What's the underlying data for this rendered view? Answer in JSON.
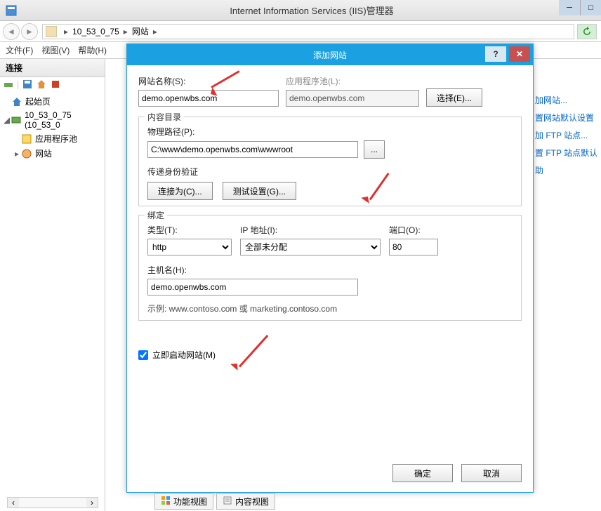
{
  "titlebar": {
    "title": "Internet Information Services (IIS)管理器"
  },
  "nav": {
    "server": "10_53_0_75",
    "node": "网站"
  },
  "menu": {
    "file": "文件(F)",
    "view": "视图(V)",
    "help": "帮助(H)"
  },
  "connections": {
    "header": "连接",
    "startpage": "起始页",
    "server": "10_53_0_75 (10_53_0",
    "apppools": "应用程序池",
    "sites": "网站"
  },
  "actions": {
    "addsite": "加网站...",
    "setdefault": "置网站默认设置",
    "addftp": "加 FTP 站点...",
    "setftp": "置 FTP 站点默认",
    "help": "助"
  },
  "dialog": {
    "title": "添加网站",
    "sitename_lbl": "网站名称(S):",
    "sitename_val": "demo.openwbs.com",
    "apppool_lbl": "应用程序池(L):",
    "apppool_val": "demo.openwbs.com",
    "select_btn": "选择(E)...",
    "content_legend": "内容目录",
    "physpath_lbl": "物理路径(P):",
    "physpath_val": "C:\\www\\demo.openwbs.com\\wwwroot",
    "browse_btn": "...",
    "passthru_lbl": "传递身份验证",
    "connectas_btn": "连接为(C)...",
    "testset_btn": "测试设置(G)...",
    "binding_legend": "绑定",
    "type_lbl": "类型(T):",
    "type_val": "http",
    "ip_lbl": "IP 地址(I):",
    "ip_val": "全部未分配",
    "port_lbl": "端口(O):",
    "port_val": "80",
    "host_lbl": "主机名(H):",
    "host_val": "demo.openwbs.com",
    "example": "示例: www.contoso.com 或 marketing.contoso.com",
    "startnow": "立即启动网站(M)",
    "ok": "确定",
    "cancel": "取消"
  },
  "viewtabs": {
    "features": "功能视图",
    "content": "内容视图"
  }
}
